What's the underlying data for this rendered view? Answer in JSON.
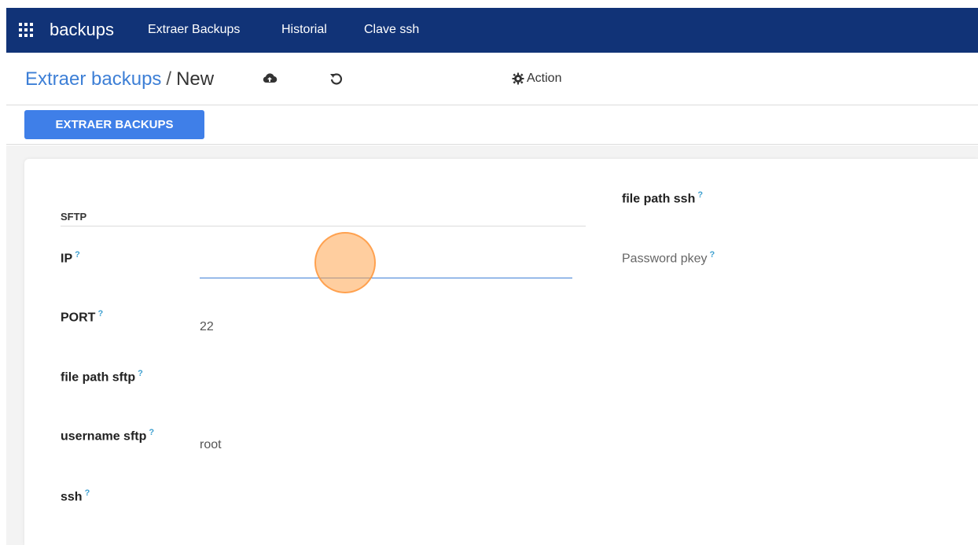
{
  "navbar": {
    "brand": "backups",
    "items": [
      {
        "label": "Extraer Backups"
      },
      {
        "label": "Historial"
      },
      {
        "label": "Clave ssh"
      }
    ]
  },
  "control": {
    "breadcrumb_link": "Extraer backups",
    "breadcrumb_sep": "/",
    "breadcrumb_current": "New",
    "action_label": "Action"
  },
  "statusbar": {
    "button_label": "EXTRAER BACKUPS"
  },
  "form": {
    "section_title": "SFTP",
    "help_mark": "?",
    "ip": {
      "label": "IP",
      "value": ""
    },
    "port": {
      "label": "PORT",
      "value": "22"
    },
    "file_path_sftp": {
      "label": "file path sftp",
      "value": ""
    },
    "username_sftp": {
      "label": "username sftp",
      "value": "root"
    },
    "ssh": {
      "label": "ssh",
      "value": ""
    },
    "file_path_ssh": {
      "label": "file path ssh",
      "value": ""
    },
    "password_pkey": {
      "label": "Password pkey",
      "value": ""
    }
  },
  "colors": {
    "navbar": "#113377",
    "link": "#3d7fd6",
    "primary": "#3f7fe8",
    "help": "#3fa0d0",
    "click_indicator": "#ffa550"
  },
  "icons": [
    "apps-grid-icon",
    "cloud-upload-icon",
    "undo-icon",
    "gear-icon"
  ]
}
